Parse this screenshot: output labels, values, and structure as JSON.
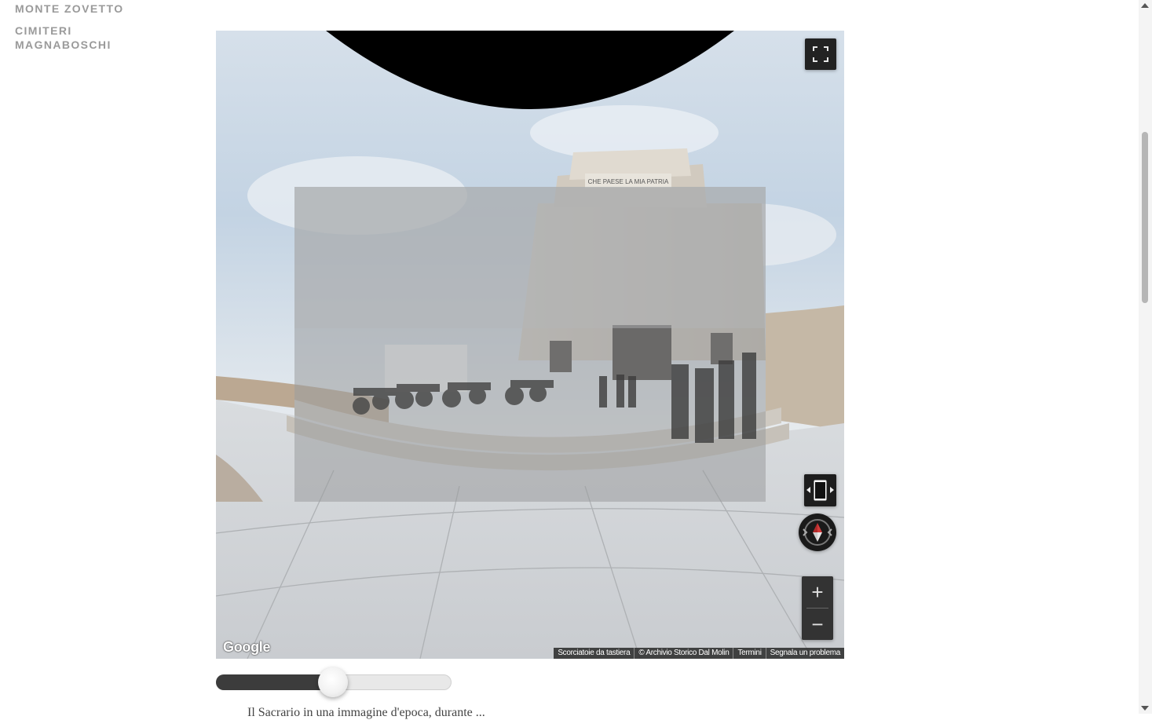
{
  "nav": {
    "items": [
      {
        "label": "MONTE ZOVETTO"
      },
      {
        "label": "CIMITERI MAGNABOSCHI"
      }
    ]
  },
  "viewer": {
    "logo_text": "Google",
    "attribution": [
      "Scorciatoie da tastiera",
      "© Archivio Storico Dal Molin",
      "Termini",
      "Segnala un problema"
    ],
    "controls": {
      "fullscreen": "fullscreen-icon",
      "overlay_toggle": "overlay-toggle-icon",
      "compass": "compass-icon",
      "zoom_in_label": "+",
      "zoom_out_label": "−"
    },
    "monument_inscription": "CHE PAESE LA MIA PATRIA"
  },
  "slider": {
    "value_fraction": 0.5
  },
  "body_text": "Il Sacrario in una immagine d'epoca, durante ...",
  "colors": {
    "nav_text": "#9a9a9a",
    "control_bg": "#222222",
    "slider_fill": "#3c3c3c"
  }
}
